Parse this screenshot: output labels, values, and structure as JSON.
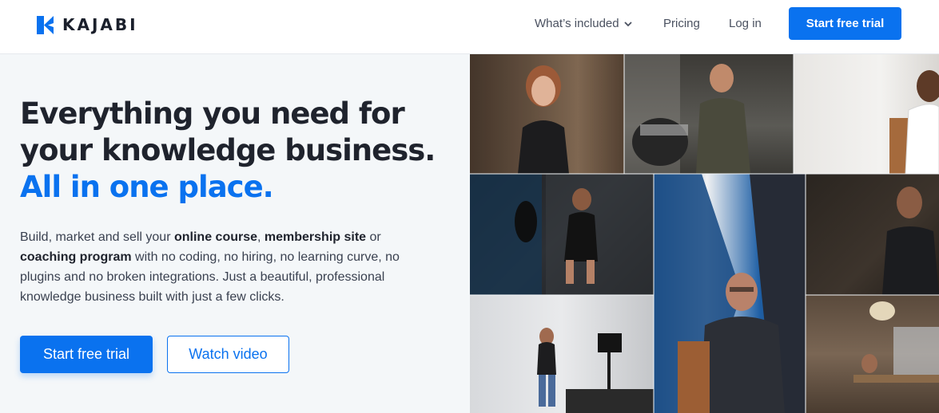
{
  "brand": {
    "name": "KAJABI",
    "accent": "#0a72ef",
    "icon": "kajabi-logo-icon"
  },
  "nav": {
    "whats_included": "What’s included",
    "pricing": "Pricing",
    "login": "Log in",
    "cta": "Start free trial"
  },
  "hero": {
    "headline_line1": "Everything you need for",
    "headline_line2": "your knowledge business.",
    "headline_accent": "All in one place.",
    "body": {
      "t1": "Build, market and sell your ",
      "b1": "online course",
      "t2": ", ",
      "b2": "membership site",
      "t3": " or ",
      "b3": "coaching program",
      "t4": " with no coding, no hiring, no learning curve, no plugins and no broken integrations. Just a beautiful, professional knowledge business built with just a few clicks."
    },
    "primary_cta": "Start free trial",
    "secondary_cta": "Watch video"
  }
}
